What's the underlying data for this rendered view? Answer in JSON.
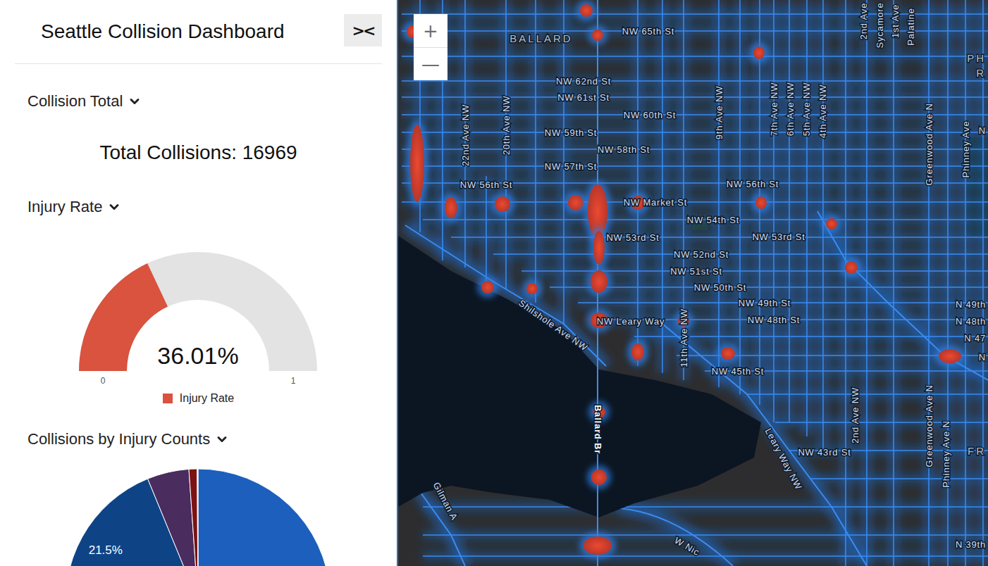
{
  "sidebar": {
    "title": "Seattle Collision Dashboard",
    "collapse_button": "><",
    "sections": {
      "total": {
        "header": "Collision Total",
        "expanded": true,
        "text": "Total Collisions: 16969"
      },
      "injury_rate": {
        "header": "Injury Rate",
        "expanded": true,
        "value_text": "36.01%",
        "level": 0.3601,
        "min_label": "0",
        "max_label": "1",
        "legend": "Injury Rate",
        "color": "#d9533f"
      },
      "injury_counts": {
        "header": "Collisions by Injury Counts",
        "expanded": true,
        "slices": [
          {
            "value": 72.3,
            "color": "#1c5fbd"
          },
          {
            "value": 21.5,
            "label": "21.5%",
            "color": "#0e4486"
          },
          {
            "value": 5.1,
            "color": "#4a2c5e"
          },
          {
            "value": 1.0,
            "color": "#7c1212"
          },
          {
            "value": 0.1,
            "color": "#f3d6d6"
          }
        ]
      }
    }
  },
  "map": {
    "zoom_buttons": [
      {
        "text": "+"
      },
      {
        "text": "—"
      }
    ],
    "labels": [
      {
        "text": "BALLARD",
        "kind": "district"
      },
      {
        "text": "NW 65th St",
        "kind": "street"
      },
      {
        "text": "2nd Ave",
        "kind": "street"
      },
      {
        "text": "Sycamore",
        "kind": "street"
      },
      {
        "text": "1st Ave",
        "kind": "street"
      },
      {
        "text": "Palatine",
        "kind": "street"
      },
      {
        "text": "PH",
        "kind": "district"
      },
      {
        "text": "R",
        "kind": "district"
      },
      {
        "text": "NW 62nd St",
        "kind": "street"
      },
      {
        "text": "NW 61st St",
        "kind": "street"
      },
      {
        "text": "NW 60th St",
        "kind": "street"
      },
      {
        "text": "NW 59th St",
        "kind": "street"
      },
      {
        "text": "NW 58th St",
        "kind": "street"
      },
      {
        "text": "NW 57th St",
        "kind": "street"
      },
      {
        "text": "NW 56th St",
        "kind": "street"
      },
      {
        "text": "NW 56th St",
        "kind": "street"
      },
      {
        "text": "NW Market St",
        "kind": "street"
      },
      {
        "text": "NW 54th St",
        "kind": "street"
      },
      {
        "text": "NW 53rd St",
        "kind": "street"
      },
      {
        "text": "NW 53rd St",
        "kind": "street"
      },
      {
        "text": "NW 52nd St",
        "kind": "street"
      },
      {
        "text": "NW 51st St",
        "kind": "street"
      },
      {
        "text": "NW 50th St",
        "kind": "street"
      },
      {
        "text": "NW 49th St",
        "kind": "street"
      },
      {
        "text": "NW 48th St",
        "kind": "street"
      },
      {
        "text": "NW Leary Way",
        "kind": "street"
      },
      {
        "text": "NW 45th St",
        "kind": "street"
      },
      {
        "text": "NW 43rd St",
        "kind": "street"
      },
      {
        "text": "22nd Ave NW",
        "kind": "street"
      },
      {
        "text": "20th Ave NW",
        "kind": "street"
      },
      {
        "text": "9th Ave NW",
        "kind": "street"
      },
      {
        "text": "7th Ave NW",
        "kind": "street"
      },
      {
        "text": "6th Ave NW",
        "kind": "street"
      },
      {
        "text": "5th Ave NW",
        "kind": "street"
      },
      {
        "text": "4th Ave NW",
        "kind": "street"
      },
      {
        "text": "Greenwood Ave N",
        "kind": "street"
      },
      {
        "text": "Phinney Ave",
        "kind": "street"
      },
      {
        "text": "11th Ave NW",
        "kind": "street"
      },
      {
        "text": "Ballard Br",
        "kind": "bridge"
      },
      {
        "text": "Shilshole Ave NW",
        "kind": "street"
      },
      {
        "text": "Leary Way NW",
        "kind": "street"
      },
      {
        "text": "2nd Ave NW",
        "kind": "street"
      },
      {
        "text": "Greenwood Ave N",
        "kind": "street"
      },
      {
        "text": "Phinney Ave N",
        "kind": "street"
      },
      {
        "text": "Gilman A",
        "kind": "street"
      },
      {
        "text": "W Nic",
        "kind": "street"
      },
      {
        "text": "N 49th",
        "kind": "street"
      },
      {
        "text": "N 48th",
        "kind": "street"
      },
      {
        "text": "N 47",
        "kind": "street"
      },
      {
        "text": "N",
        "kind": "street"
      },
      {
        "text": "N",
        "kind": "street"
      },
      {
        "text": "FR",
        "kind": "district"
      },
      {
        "text": "N 39th",
        "kind": "street"
      }
    ]
  }
}
